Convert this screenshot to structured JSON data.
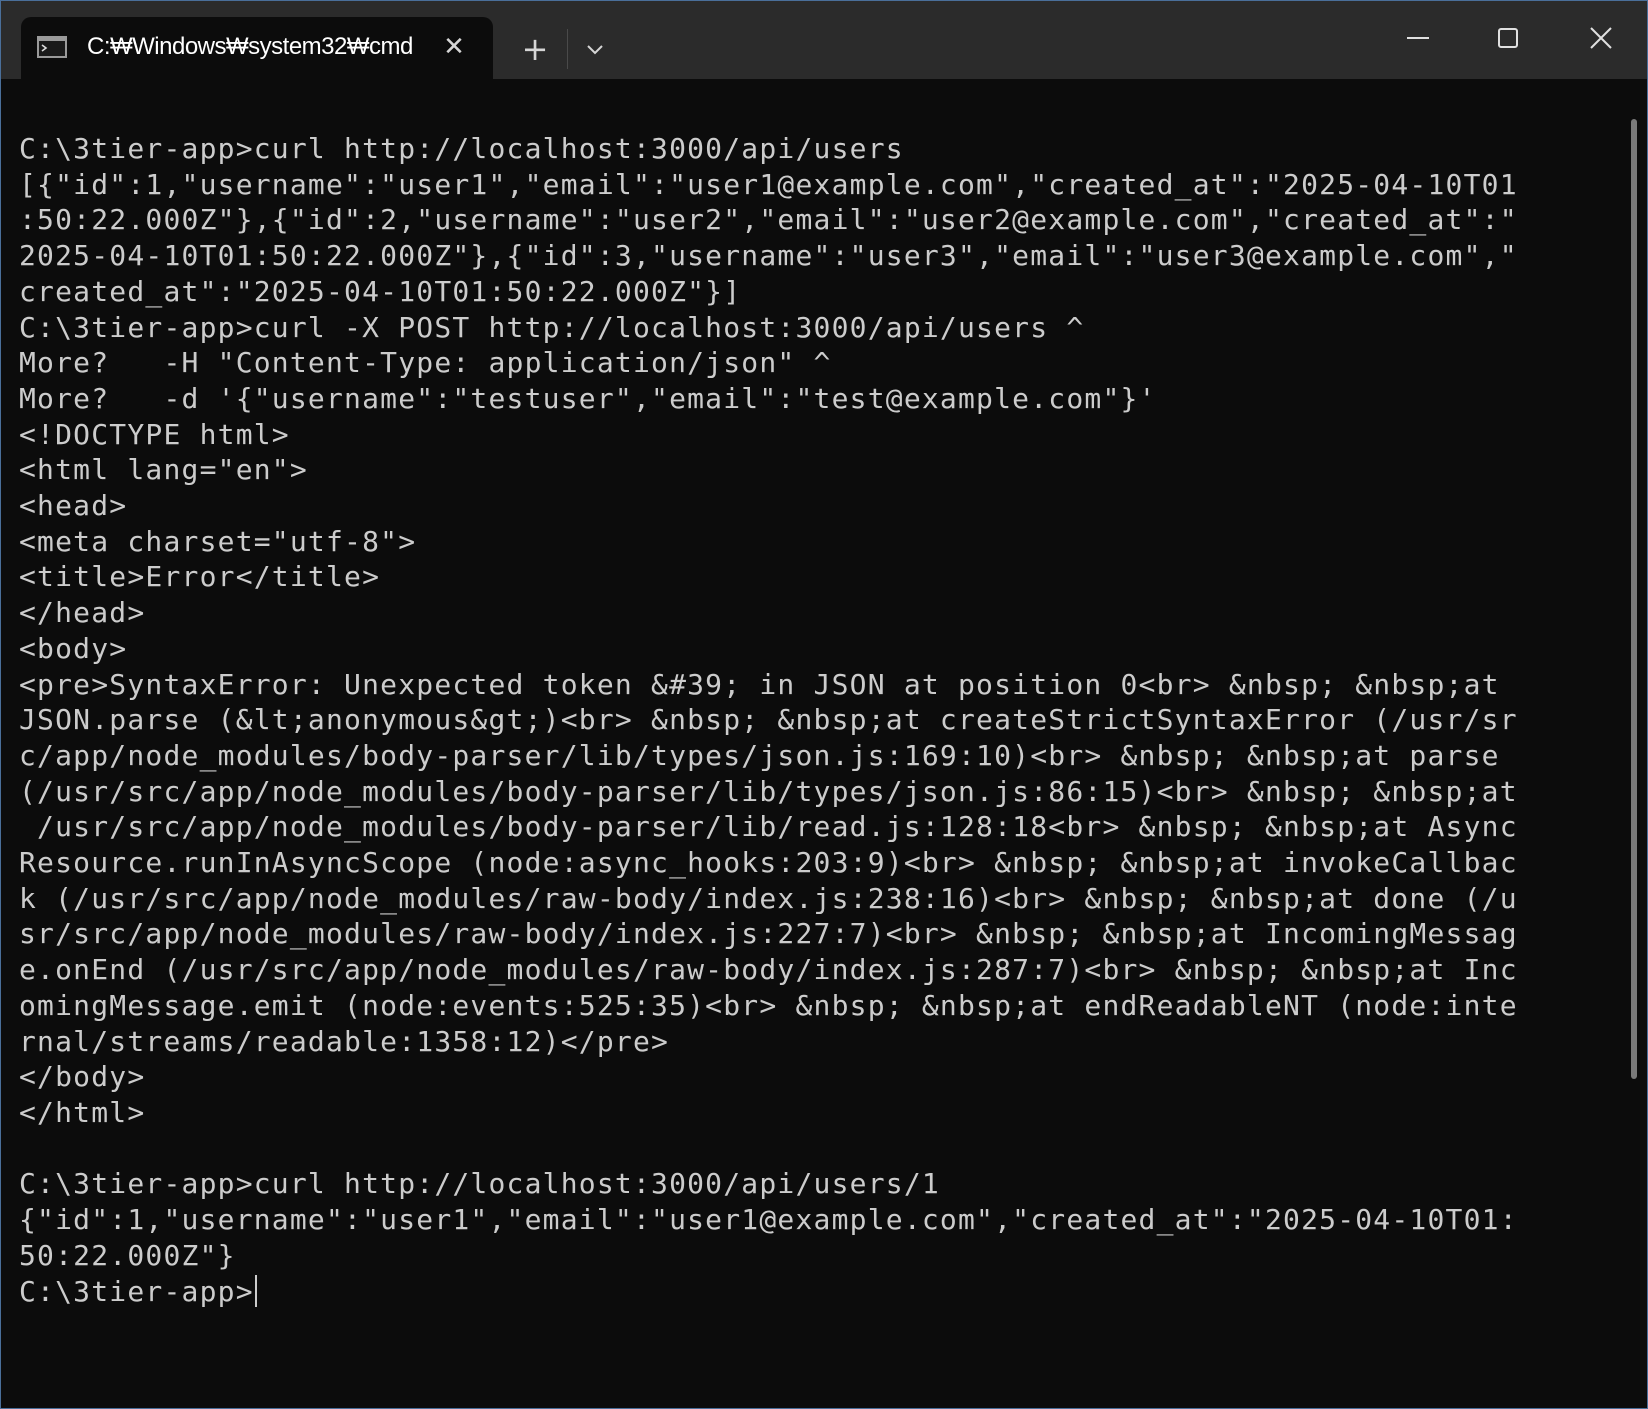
{
  "window": {
    "tab_title": "C:₩Windows₩system32₩cmd",
    "tab_close": "✕",
    "new_tab": "+",
    "icons": {
      "tab": "console-icon",
      "dropdown": "chevron-down-icon",
      "minimize": "minimize-icon",
      "maximize": "maximize-icon",
      "close": "close-icon"
    }
  },
  "colors": {
    "background": "#0c0c0c",
    "titlebar": "#2b2b2b",
    "text": "#cccccc"
  },
  "terminal": {
    "lines": [
      "C:\\3tier-app>curl http://localhost:3000/api/users",
      "[{\"id\":1,\"username\":\"user1\",\"email\":\"user1@example.com\",\"created_at\":\"2025-04-10T01",
      ":50:22.000Z\"},{\"id\":2,\"username\":\"user2\",\"email\":\"user2@example.com\",\"created_at\":\"",
      "2025-04-10T01:50:22.000Z\"},{\"id\":3,\"username\":\"user3\",\"email\":\"user3@example.com\",\"",
      "created_at\":\"2025-04-10T01:50:22.000Z\"}]",
      "C:\\3tier-app>curl -X POST http://localhost:3000/api/users ^",
      "More?   -H \"Content-Type: application/json\" ^",
      "More?   -d '{\"username\":\"testuser\",\"email\":\"test@example.com\"}'",
      "<!DOCTYPE html>",
      "<html lang=\"en\">",
      "<head>",
      "<meta charset=\"utf-8\">",
      "<title>Error</title>",
      "</head>",
      "<body>",
      "<pre>SyntaxError: Unexpected token &#39; in JSON at position 0<br> &nbsp; &nbsp;at",
      "JSON.parse (&lt;anonymous&gt;)<br> &nbsp; &nbsp;at createStrictSyntaxError (/usr/sr",
      "c/app/node_modules/body-parser/lib/types/json.js:169:10)<br> &nbsp; &nbsp;at parse",
      "(/usr/src/app/node_modules/body-parser/lib/types/json.js:86:15)<br> &nbsp; &nbsp;at",
      " /usr/src/app/node_modules/body-parser/lib/read.js:128:18<br> &nbsp; &nbsp;at Async",
      "Resource.runInAsyncScope (node:async_hooks:203:9)<br> &nbsp; &nbsp;at invokeCallbac",
      "k (/usr/src/app/node_modules/raw-body/index.js:238:16)<br> &nbsp; &nbsp;at done (/u",
      "sr/src/app/node_modules/raw-body/index.js:227:7)<br> &nbsp; &nbsp;at IncomingMessag",
      "e.onEnd (/usr/src/app/node_modules/raw-body/index.js:287:7)<br> &nbsp; &nbsp;at Inc",
      "omingMessage.emit (node:events:525:35)<br> &nbsp; &nbsp;at endReadableNT (node:inte",
      "rnal/streams/readable:1358:12)</pre>",
      "</body>",
      "</html>",
      "",
      "C:\\3tier-app>curl http://localhost:3000/api/users/1",
      "{\"id\":1,\"username\":\"user1\",\"email\":\"user1@example.com\",\"created_at\":\"2025-04-10T01:",
      "50:22.000Z\"}"
    ],
    "prompt": "C:\\3tier-app>"
  }
}
